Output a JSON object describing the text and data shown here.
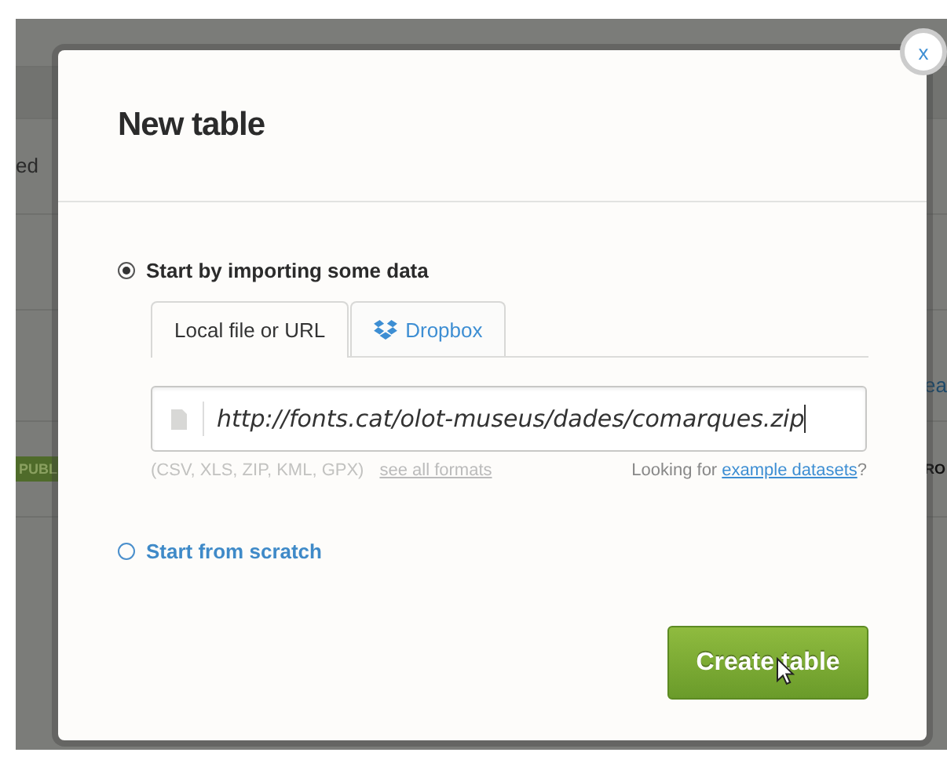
{
  "background": {
    "fragments": [
      "ed",
      "PUBL"
    ],
    "right_fragments": [
      "ea",
      "RO"
    ]
  },
  "dialog": {
    "title": "New table",
    "close": "x",
    "options": [
      {
        "label": "Start by importing some data",
        "selected": true
      },
      {
        "label": "Start from scratch",
        "selected": false
      }
    ],
    "tabs": [
      {
        "label": "Local file or URL",
        "selected": true,
        "kind": "plain"
      },
      {
        "label": "Dropbox",
        "selected": false,
        "kind": "dropbox"
      }
    ],
    "url_field": {
      "value": "http://fonts.cat/olot-museus/dades/comarques.zip"
    },
    "formats": "(CSV, XLS, ZIP, KML, GPX)",
    "formats_link": "see all formats",
    "examples_prefix": "Looking for ",
    "examples_link": "example datasets",
    "examples_suffix": "?",
    "create_button": "Create table"
  }
}
